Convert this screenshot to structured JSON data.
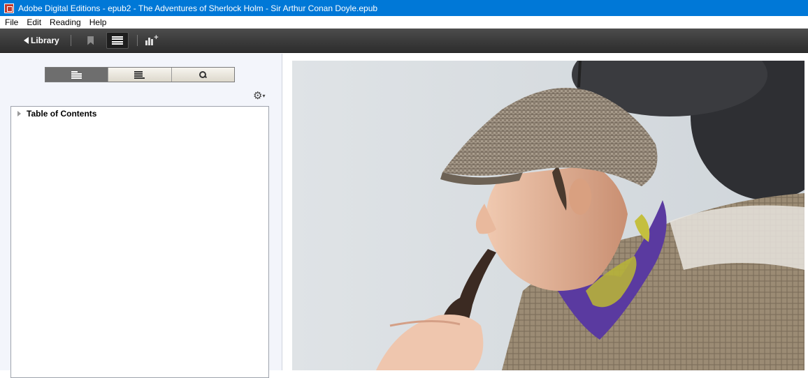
{
  "window": {
    "title": "Adobe Digital Editions - epub2 - The Adventures of Sherlock Holm - Sir Arthur Conan Doyle.epub"
  },
  "menu": {
    "items": [
      "File",
      "Edit",
      "Reading",
      "Help"
    ]
  },
  "toolbar": {
    "library_label": "Library",
    "icons": [
      "bookmark-icon",
      "toc-list-icon",
      "stats-add-icon"
    ]
  },
  "panel": {
    "tabs": [
      "table-of-contents-icon",
      "bookmarks-icon",
      "search-icon"
    ],
    "active_tab": "table-of-contents-icon",
    "options_icon": "gear-icon",
    "toc_label": "Table of Contents"
  },
  "colors": {
    "titlebar": "#0078d7",
    "toolbar": "#3a3a3a",
    "panel": "#f3f5fb"
  }
}
